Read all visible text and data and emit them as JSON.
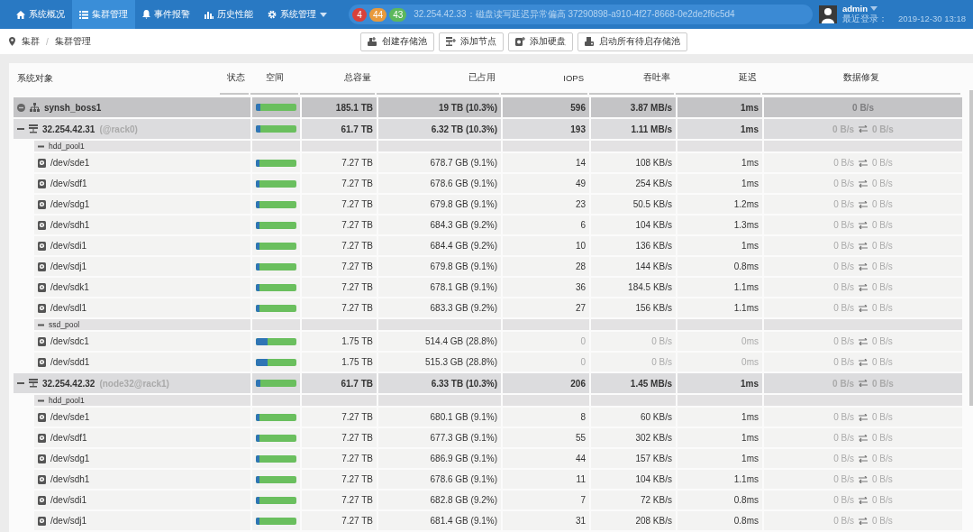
{
  "nav": {
    "items": [
      {
        "label": "系统概况",
        "selected": false,
        "dropdown": false
      },
      {
        "label": "集群管理",
        "selected": true,
        "dropdown": false
      },
      {
        "label": "事件报警",
        "selected": false,
        "dropdown": false
      },
      {
        "label": "历史性能",
        "selected": false,
        "dropdown": false
      },
      {
        "label": "系统管理",
        "selected": false,
        "dropdown": true
      }
    ],
    "alerts": {
      "counts": [
        {
          "value": "4",
          "color": "#d9413a"
        },
        {
          "value": "44",
          "color": "#e99a3c"
        },
        {
          "value": "43",
          "color": "#5cb85c"
        }
      ],
      "message": "32.254.42.33：磁盘读写延迟异常偏高 37290898-a910-4f27-8668-0e2de2f6c5d4"
    },
    "user": {
      "name": "admin",
      "last_login_label": "最近登录：",
      "last_login": "2019-12-30 13:18"
    }
  },
  "breadcrumb": {
    "items": [
      "集群",
      "集群管理"
    ],
    "separator": "/"
  },
  "toolbar": [
    "创建存储池",
    "添加节点",
    "添加硬盘",
    "启动所有待启存储池"
  ],
  "table": {
    "columns": [
      "系统对象",
      "状态",
      "空间",
      "总容量",
      "已占用",
      "IOPS",
      "吞吐率",
      "延迟",
      "数据修复"
    ],
    "rows": [
      {
        "kind": "root",
        "name": "synsh_boss1",
        "expanded": true,
        "level": 0.103,
        "total": "185.1 TB",
        "used": "19 TB (10.3%)",
        "iops": "596",
        "throughput": "3.87 MB/s",
        "latency": "1ms",
        "repair": "0 B/s",
        "children": [
          {
            "kind": "host",
            "name": "32.254.42.31",
            "suffix": "(@rack0)",
            "expanded": true,
            "level": 0.103,
            "total": "61.7 TB",
            "used": "6.32 TB (10.3%)",
            "iops": "193",
            "throughput": "1.11 MB/s",
            "latency": "1ms",
            "repair_in": "0 B/s",
            "repair_out": "0 B/s",
            "children": [
              {
                "kind": "pool",
                "name": "hdd_pool1",
                "expanded": true,
                "children": [
                  {
                    "kind": "disk",
                    "name": "/dev/sde1",
                    "idle": false,
                    "level": 0.091,
                    "total": "7.27 TB",
                    "used": "678.7 GB (9.1%)",
                    "iops": "14",
                    "throughput": "108 KB/s",
                    "latency": "1ms",
                    "repair_in": "0 B/s",
                    "repair_out": "0 B/s"
                  },
                  {
                    "kind": "disk",
                    "name": "/dev/sdf1",
                    "idle": false,
                    "level": 0.091,
                    "total": "7.27 TB",
                    "used": "678.6 GB (9.1%)",
                    "iops": "49",
                    "throughput": "254 KB/s",
                    "latency": "1ms",
                    "repair_in": "0 B/s",
                    "repair_out": "0 B/s"
                  },
                  {
                    "kind": "disk",
                    "name": "/dev/sdg1",
                    "idle": false,
                    "level": 0.091,
                    "total": "7.27 TB",
                    "used": "679.8 GB (9.1%)",
                    "iops": "23",
                    "throughput": "50.5 KB/s",
                    "latency": "1.2ms",
                    "repair_in": "0 B/s",
                    "repair_out": "0 B/s"
                  },
                  {
                    "kind": "disk",
                    "name": "/dev/sdh1",
                    "idle": false,
                    "level": 0.092,
                    "total": "7.27 TB",
                    "used": "684.3 GB (9.2%)",
                    "iops": "6",
                    "throughput": "104 KB/s",
                    "latency": "1.3ms",
                    "repair_in": "0 B/s",
                    "repair_out": "0 B/s"
                  },
                  {
                    "kind": "disk",
                    "name": "/dev/sdi1",
                    "idle": false,
                    "level": 0.092,
                    "total": "7.27 TB",
                    "used": "684.4 GB (9.2%)",
                    "iops": "10",
                    "throughput": "136 KB/s",
                    "latency": "1ms",
                    "repair_in": "0 B/s",
                    "repair_out": "0 B/s"
                  },
                  {
                    "kind": "disk",
                    "name": "/dev/sdj1",
                    "idle": false,
                    "level": 0.091,
                    "total": "7.27 TB",
                    "used": "679.8 GB (9.1%)",
                    "iops": "28",
                    "throughput": "144 KB/s",
                    "latency": "0.8ms",
                    "repair_in": "0 B/s",
                    "repair_out": "0 B/s"
                  },
                  {
                    "kind": "disk",
                    "name": "/dev/sdk1",
                    "idle": false,
                    "level": 0.091,
                    "total": "7.27 TB",
                    "used": "678.1 GB (9.1%)",
                    "iops": "36",
                    "throughput": "184.5 KB/s",
                    "latency": "1.1ms",
                    "repair_in": "0 B/s",
                    "repair_out": "0 B/s"
                  },
                  {
                    "kind": "disk",
                    "name": "/dev/sdl1",
                    "idle": false,
                    "level": 0.092,
                    "total": "7.27 TB",
                    "used": "683.3 GB (9.2%)",
                    "iops": "27",
                    "throughput": "156 KB/s",
                    "latency": "1.1ms",
                    "repair_in": "0 B/s",
                    "repair_out": "0 B/s"
                  }
                ]
              },
              {
                "kind": "pool",
                "name": "ssd_pool",
                "expanded": true,
                "children": [
                  {
                    "kind": "disk",
                    "name": "/dev/sdc1",
                    "idle": true,
                    "level": 0.288,
                    "total": "1.75 TB",
                    "used": "514.4 GB (28.8%)",
                    "iops": "0",
                    "throughput": "0 B/s",
                    "latency": "0ms",
                    "repair_in": "0 B/s",
                    "repair_out": "0 B/s"
                  },
                  {
                    "kind": "disk",
                    "name": "/dev/sdd1",
                    "idle": true,
                    "level": 0.288,
                    "total": "1.75 TB",
                    "used": "515.3 GB (28.8%)",
                    "iops": "0",
                    "throughput": "0 B/s",
                    "latency": "0ms",
                    "repair_in": "0 B/s",
                    "repair_out": "0 B/s"
                  }
                ]
              }
            ]
          },
          {
            "kind": "host",
            "name": "32.254.42.32",
            "suffix": "(node32@rack1)",
            "expanded": true,
            "level": 0.103,
            "total": "61.7 TB",
            "used": "6.33 TB (10.3%)",
            "iops": "206",
            "throughput": "1.45 MB/s",
            "latency": "1ms",
            "repair_in": "0 B/s",
            "repair_out": "0 B/s",
            "children": [
              {
                "kind": "pool",
                "name": "hdd_pool1",
                "expanded": true,
                "children": [
                  {
                    "kind": "disk",
                    "name": "/dev/sde1",
                    "idle": false,
                    "level": 0.091,
                    "total": "7.27 TB",
                    "used": "680.1 GB (9.1%)",
                    "iops": "8",
                    "throughput": "60 KB/s",
                    "latency": "1ms",
                    "repair_in": "0 B/s",
                    "repair_out": "0 B/s"
                  },
                  {
                    "kind": "disk",
                    "name": "/dev/sdf1",
                    "idle": false,
                    "level": 0.091,
                    "total": "7.27 TB",
                    "used": "677.3 GB (9.1%)",
                    "iops": "55",
                    "throughput": "302 KB/s",
                    "latency": "1ms",
                    "repair_in": "0 B/s",
                    "repair_out": "0 B/s"
                  },
                  {
                    "kind": "disk",
                    "name": "/dev/sdg1",
                    "idle": false,
                    "level": 0.091,
                    "total": "7.27 TB",
                    "used": "686.9 GB (9.1%)",
                    "iops": "44",
                    "throughput": "157 KB/s",
                    "latency": "1ms",
                    "repair_in": "0 B/s",
                    "repair_out": "0 B/s"
                  },
                  {
                    "kind": "disk",
                    "name": "/dev/sdh1",
                    "idle": false,
                    "level": 0.091,
                    "total": "7.27 TB",
                    "used": "678.6 GB (9.1%)",
                    "iops": "11",
                    "throughput": "104 KB/s",
                    "latency": "1.1ms",
                    "repair_in": "0 B/s",
                    "repair_out": "0 B/s"
                  },
                  {
                    "kind": "disk",
                    "name": "/dev/sdi1",
                    "idle": false,
                    "level": 0.092,
                    "total": "7.27 TB",
                    "used": "682.8 GB (9.2%)",
                    "iops": "7",
                    "throughput": "72 KB/s",
                    "latency": "0.8ms",
                    "repair_in": "0 B/s",
                    "repair_out": "0 B/s"
                  },
                  {
                    "kind": "disk",
                    "name": "/dev/sdj1",
                    "idle": false,
                    "level": 0.091,
                    "total": "7.27 TB",
                    "used": "681.4 GB (9.1%)",
                    "iops": "31",
                    "throughput": "208 KB/s",
                    "latency": "0.8ms",
                    "repair_in": "0 B/s",
                    "repair_out": "0 B/s"
                  }
                ]
              }
            ]
          }
        ]
      }
    ]
  }
}
